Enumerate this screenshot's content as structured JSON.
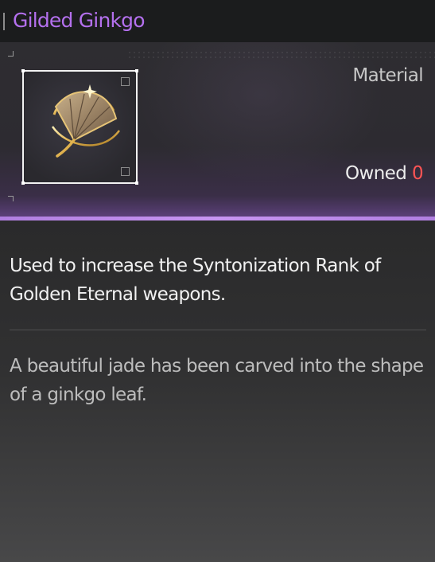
{
  "item": {
    "name": "Gilded Ginkgo",
    "category": "Material",
    "owned_label": "Owned",
    "owned_count": "0",
    "description": "Used to increase the Syntonization Rank of Golden Eternal weapons.",
    "lore": "A beautiful jade has been carved into the shape of a ginkgo leaf.",
    "icon": "ginkgo-leaf-icon"
  },
  "colors": {
    "title": "#b470ee",
    "accent": "#c795f2",
    "owned_count": "#ff5454"
  }
}
